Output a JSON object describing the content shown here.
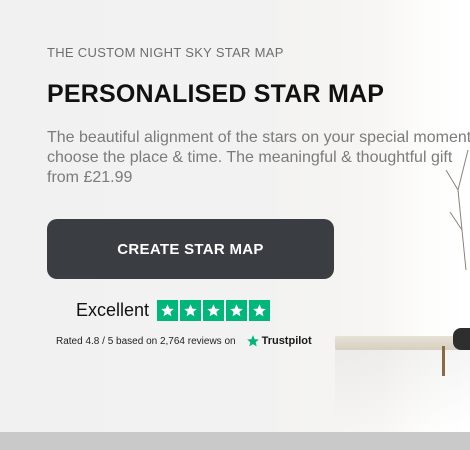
{
  "hero": {
    "subtitle": "THE CUSTOM NIGHT SKY STAR MAP",
    "title": "PERSONALISED STAR MAP",
    "description": "The beautiful alignment of the stars on your special moment, choose the place & time. The meaningful & thoughtful gift from £21.99",
    "cta_label": "CREATE STAR MAP"
  },
  "rating": {
    "word": "Excellent",
    "stars": 5,
    "rated_text": "Rated 4.8 / 5 based on 2,764 reviews on",
    "brand": "Trustpilot",
    "star_color": "#00b67a"
  },
  "colors": {
    "cta_background": "#3a3e43",
    "trustpilot_green": "#00b67a"
  }
}
